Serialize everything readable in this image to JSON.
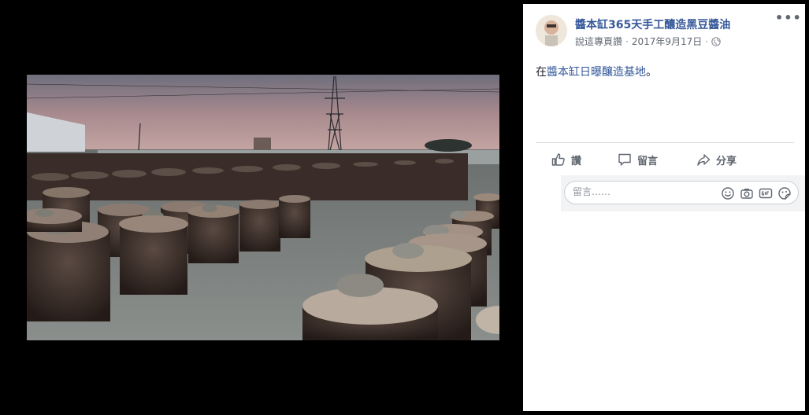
{
  "post": {
    "page_name": "醬本缸365天手工釀造黑豆醬油",
    "subtitle": "說這專頁讚",
    "separator": "·",
    "date": "2017年9月17日",
    "separator2": "·",
    "text_prefix": "在",
    "text_link": "醬本缸日曝釀造基地",
    "text_suffix": "。",
    "more_label": "•••"
  },
  "actions": {
    "like_label": "讚",
    "comment_label": "留言",
    "share_label": "分享"
  },
  "comment": {
    "placeholder": "留言……"
  },
  "icons": {
    "globe": "globe-icon",
    "like": "thumbs-up-icon",
    "comment": "speech-bubble-icon",
    "share": "share-arrow-icon",
    "emoji": "smiley-icon",
    "camera": "camera-icon",
    "gif": "gif-icon",
    "sticker": "sticker-icon"
  },
  "colors": {
    "link": "#365899",
    "meta": "#616770",
    "viewer_bg": "#000000"
  }
}
